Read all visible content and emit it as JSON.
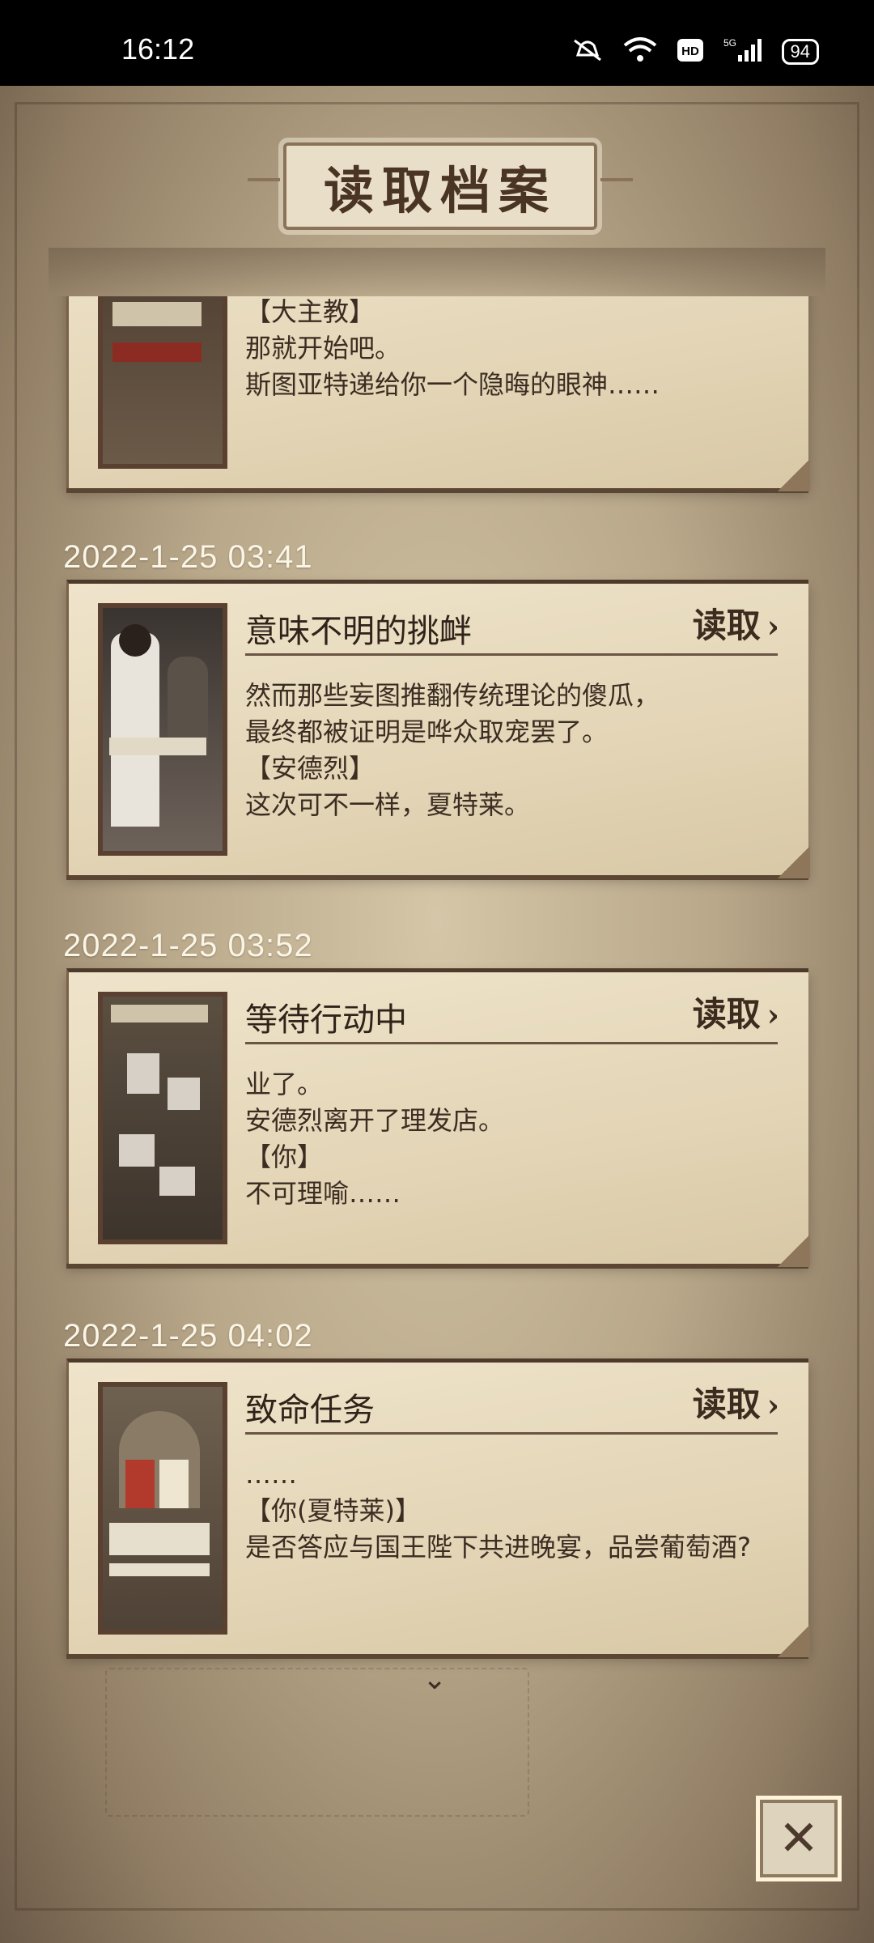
{
  "status_bar": {
    "time": "16:12",
    "icons": [
      "mute-icon",
      "wifi-icon",
      "hd-icon",
      "5g-signal-icon"
    ],
    "battery": "94"
  },
  "screen": {
    "title": "读取档案",
    "load_label": "读取",
    "close_glyph": "✕"
  },
  "saves": [
    {
      "date": "",
      "title": "",
      "text": "【大主教】\n那就开始吧。\n斯图亚特递给你一个隐晦的眼神……"
    },
    {
      "date": "2022-1-25  03:41",
      "title": "意味不明的挑衅",
      "text": "然而那些妄图推翻传统理论的傻瓜，\n最终都被证明是哗众取宠罢了。\n【安德烈】\n这次可不一样，夏特莱。"
    },
    {
      "date": "2022-1-25  03:52",
      "title": "等待行动中",
      "text": "业了。\n安德烈离开了理发店。\n【你】\n不可理喻……"
    },
    {
      "date": "2022-1-25  04:02",
      "title": "致命任务",
      "text": "……\n【你(夏特莱)】\n是否答应与国王陛下共进晚宴，品尝葡萄酒?"
    }
  ]
}
